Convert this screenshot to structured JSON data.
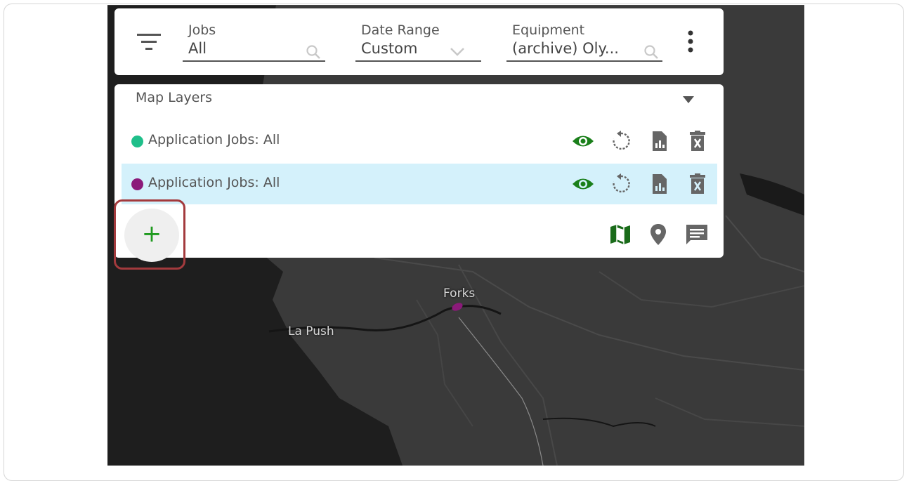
{
  "filters": {
    "jobs": {
      "label": "Jobs",
      "value": "All"
    },
    "date_range": {
      "label": "Date Range",
      "value": "Custom"
    },
    "equipment": {
      "label": "Equipment",
      "value": "(archive) Oly..."
    }
  },
  "layers_panel": {
    "title": "Map Layers",
    "layers": [
      {
        "name": "Application Jobs: All",
        "color": "#1fbf8a",
        "selected": false
      },
      {
        "name": "Application Jobs: All",
        "color": "#8b1a7a",
        "selected": true
      }
    ],
    "add_label": "+"
  },
  "map": {
    "labels": {
      "forks": "Forks",
      "la_push": "La Push"
    }
  },
  "colors": {
    "accent_green": "#1f9a1f",
    "selected_row": "#d4f1fb",
    "highlight": "#a33a3d"
  }
}
